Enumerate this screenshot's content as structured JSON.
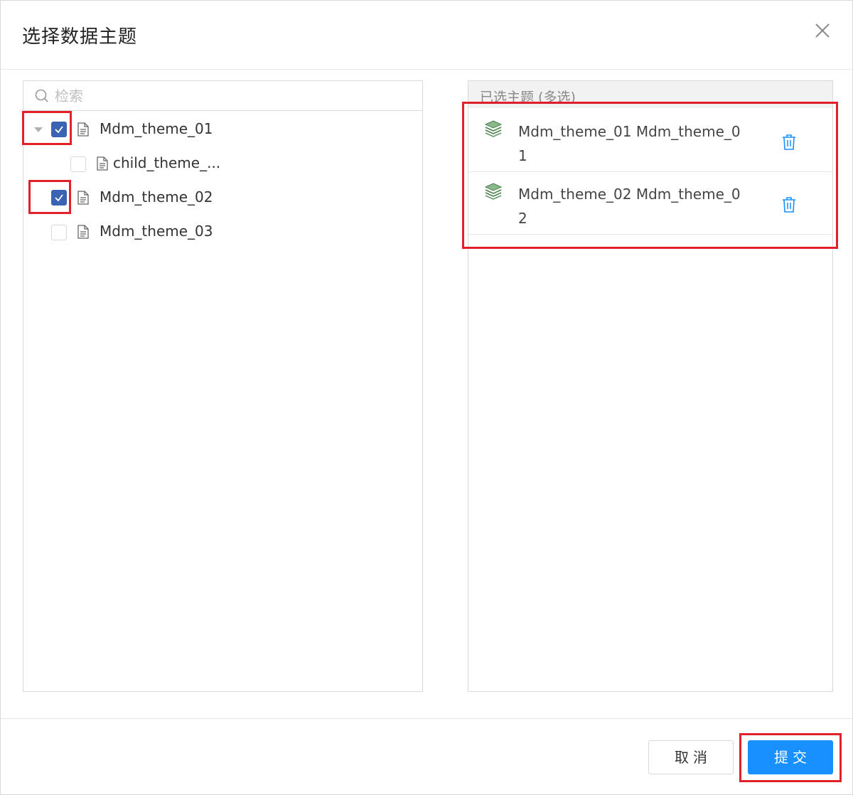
{
  "dialog": {
    "title": "选择数据主题",
    "close_icon": "close-icon"
  },
  "left": {
    "search": {
      "placeholder": "检索",
      "value": "",
      "icon": "search-icon"
    },
    "tree": [
      {
        "label": "Mdm_theme_01",
        "checked": true,
        "expanded": true,
        "icon": "document-icon"
      },
      {
        "label": "child_theme_...",
        "checked": false,
        "icon": "document-icon"
      },
      {
        "label": "Mdm_theme_02",
        "checked": true,
        "icon": "document-icon"
      },
      {
        "label": "Mdm_theme_03",
        "checked": false,
        "icon": "document-icon"
      }
    ]
  },
  "right": {
    "header": "已选主题 (多选)",
    "items": [
      {
        "text": "Mdm_theme_01   Mdm_theme_01",
        "icon": "layers-icon",
        "action_icon": "trash-icon"
      },
      {
        "text": "Mdm_theme_02   Mdm_theme_02",
        "icon": "layers-icon",
        "action_icon": "trash-icon"
      }
    ]
  },
  "footer": {
    "cancel_label": "取消",
    "submit_label": "提交"
  },
  "colors": {
    "primary": "#1890ff",
    "checkbox": "#3a64b3",
    "highlight": "#e0212a",
    "layers_icon": "#5a9a5a"
  }
}
